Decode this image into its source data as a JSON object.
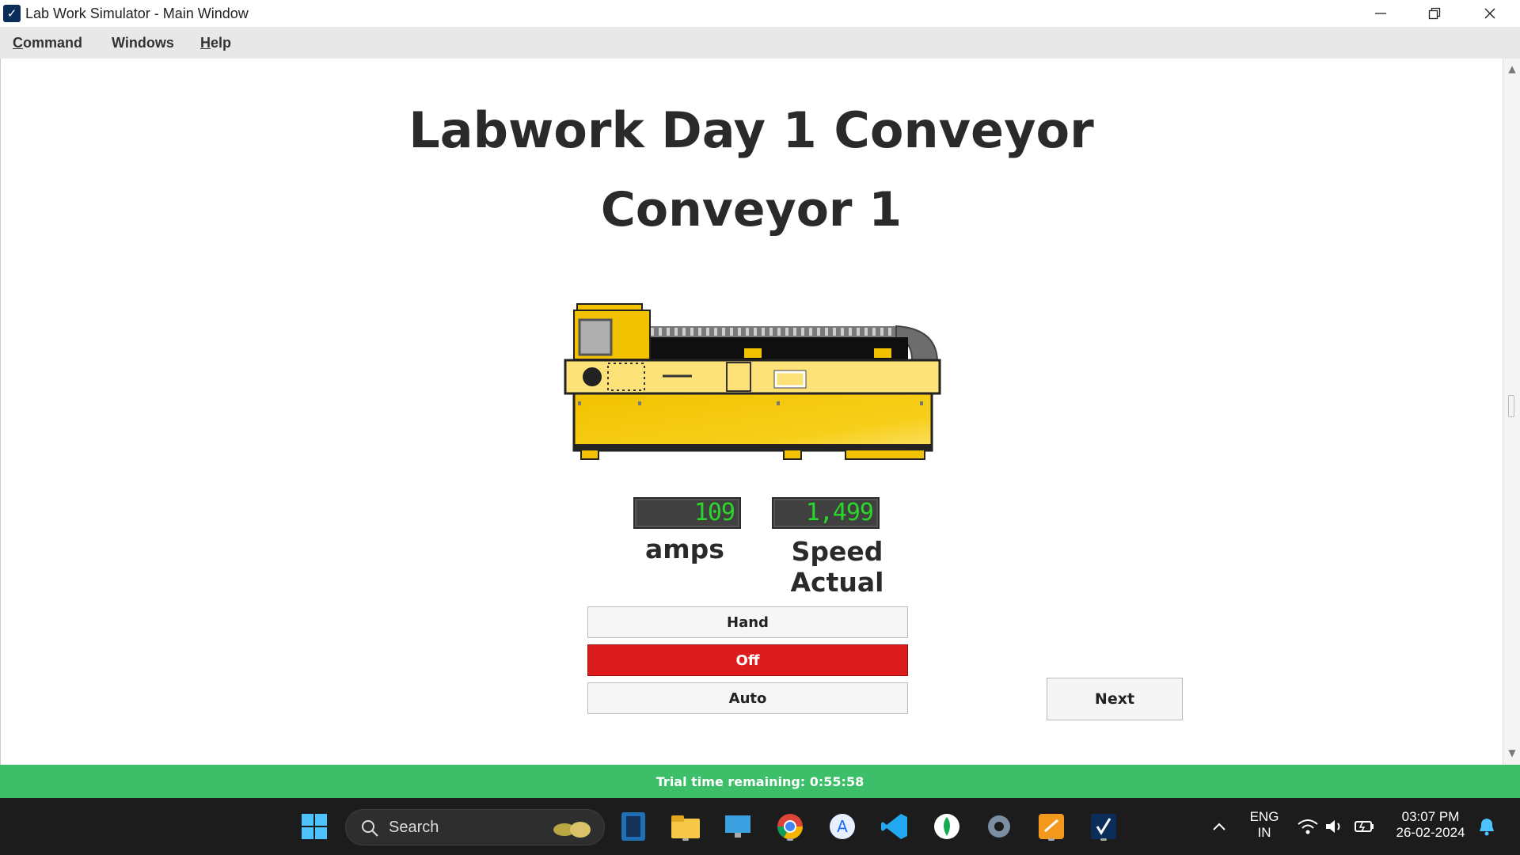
{
  "window": {
    "title": "Lab Work Simulator - Main Window",
    "icon": "app-checkmark-icon"
  },
  "menu": {
    "items": [
      {
        "underline": "C",
        "rest": "ommand"
      },
      {
        "underline": "",
        "rest": "Windows"
      },
      {
        "underline": "H",
        "rest": "elp"
      }
    ]
  },
  "main": {
    "title": "Labwork Day 1 Conveyor",
    "subtitle": "Conveyor 1",
    "amps_value": "109",
    "amps_label": "amps",
    "speed_value": "1,499",
    "speed_label": "Speed Actual",
    "modes": [
      "Hand",
      "Off",
      "Auto"
    ],
    "active_mode": "Off",
    "next_label": "Next"
  },
  "status": {
    "trial_text": "Trial time remaining: 0:55:58"
  },
  "taskbar": {
    "search_label": "Search",
    "lang_line1": "ENG",
    "lang_line2": "IN",
    "time": "03:07 PM",
    "date": "26-02-2024"
  },
  "colors": {
    "active_mode": "#dc1c1c",
    "trial_bar": "#3dbf6a",
    "display_digits": "#2bd62b",
    "conveyor_yellow": "#f5c400"
  }
}
